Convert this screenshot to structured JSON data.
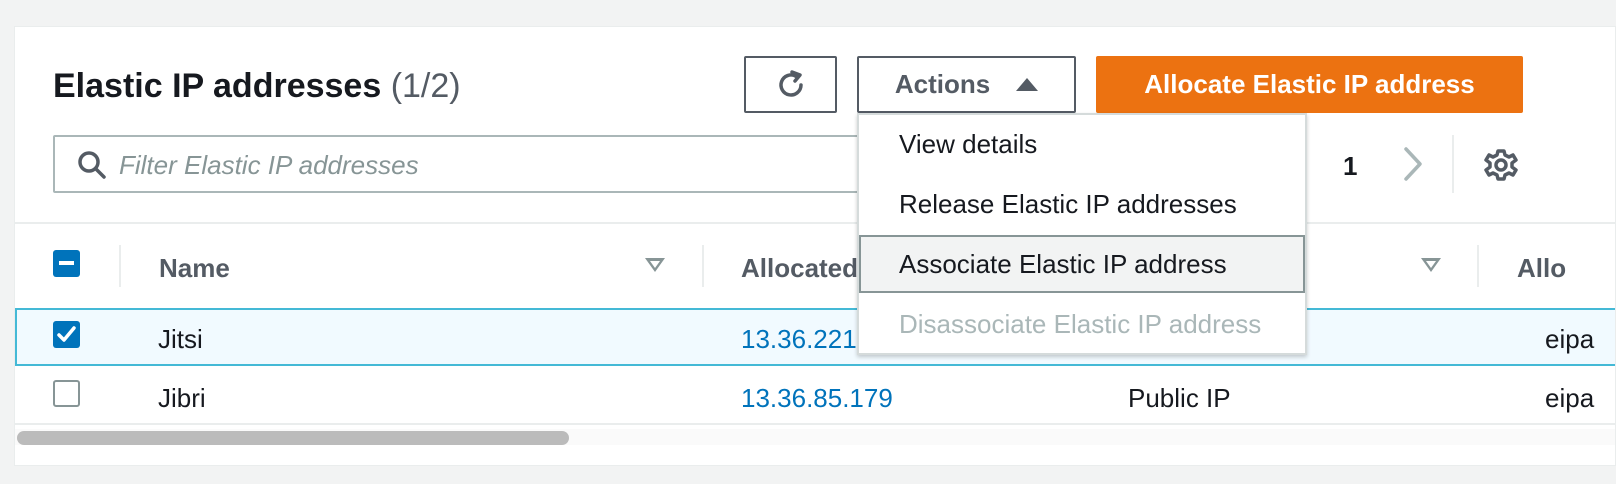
{
  "header": {
    "title": "Elastic IP addresses",
    "count": "(1/2)",
    "actions_label": "Actions",
    "allocate_label": "Allocate Elastic IP address"
  },
  "search": {
    "placeholder": "Filter Elastic IP addresses"
  },
  "pagination": {
    "current_page": "1"
  },
  "table": {
    "columns": [
      "Name",
      "Allocated",
      "",
      "Allo"
    ],
    "rows": [
      {
        "name": "Jitsi",
        "allocated_ip": "13.36.221",
        "type": "",
        "allocation_id": "eipa",
        "selected": true
      },
      {
        "name": "Jibri",
        "allocated_ip": "13.36.85.179",
        "type": "Public IP",
        "allocation_id": "eipa",
        "selected": false
      }
    ]
  },
  "actions_menu": {
    "items": [
      {
        "label": "View details",
        "state": "normal"
      },
      {
        "label": "Release Elastic IP addresses",
        "state": "normal"
      },
      {
        "label": "Associate Elastic IP address",
        "state": "hover"
      },
      {
        "label": "Disassociate Elastic IP address",
        "state": "disabled"
      }
    ]
  },
  "colors": {
    "primary_button": "#ec7211",
    "link": "#0073bb",
    "checkbox": "#0073bb",
    "selected_row_bg": "#f1faff",
    "selected_row_border": "#44b9d6"
  },
  "icons": {
    "refresh": "refresh-icon",
    "caret": "caret-up-icon",
    "search": "search-icon",
    "next": "chevron-right-icon",
    "settings": "gear-icon",
    "sort": "sort-down-icon"
  }
}
